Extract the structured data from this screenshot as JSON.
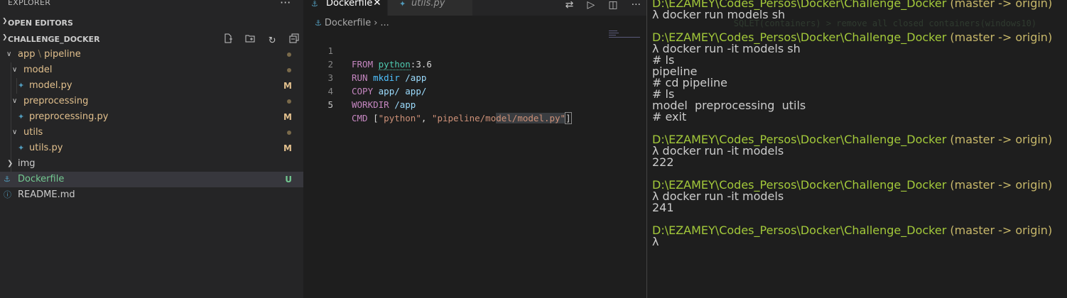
{
  "sidebar": {
    "title": "EXPLORER",
    "more_icon": "ellipsis-icon",
    "open_editors_label": "OPEN EDITORS",
    "project_label": "CHALLENGE_DOCKER",
    "project_tools": [
      "new-file-icon",
      "new-folder-icon",
      "refresh-icon",
      "collapse-all-icon"
    ],
    "tree": [
      {
        "name": "app",
        "name2": "pipeline",
        "type": "folder",
        "status": ""
      },
      {
        "name": "model",
        "type": "folder",
        "status": ""
      },
      {
        "name": "model.py",
        "type": "python",
        "status": "M"
      },
      {
        "name": "preprocessing",
        "type": "folder",
        "status": ""
      },
      {
        "name": "preprocessing.py",
        "type": "python",
        "status": "M"
      },
      {
        "name": "utils",
        "type": "folder",
        "status": ""
      },
      {
        "name": "utils.py",
        "type": "python",
        "status": "M"
      },
      {
        "name": "img",
        "type": "folder",
        "status": ""
      },
      {
        "name": "Dockerfile",
        "type": "docker",
        "status": "U"
      },
      {
        "name": "README.md",
        "type": "info",
        "status": ""
      }
    ]
  },
  "editor": {
    "tabs": [
      {
        "label": "Dockerfile",
        "active": true
      },
      {
        "label": "utils.py",
        "active": false
      }
    ],
    "breadcrumb": {
      "file": "Dockerfile",
      "rest": "..."
    },
    "code": [
      {
        "n": "1",
        "t1": "FROM",
        "t2": "python",
        "t3": ":3.6"
      },
      {
        "n": "2",
        "t1": "RUN",
        "t2": "mkdir",
        "t3": " /app"
      },
      {
        "n": "3",
        "t1": "COPY",
        "t2": "app/ app/"
      },
      {
        "n": "4",
        "t1": "WORKDIR",
        "t2": " /app"
      },
      {
        "n": "5",
        "t1": "CMD",
        "t2": " [",
        "t3": "\"python\"",
        "t4": ", ",
        "t5": "\"pipeline/mo",
        "t6": "del/model.py\"",
        "t7": "]"
      }
    ]
  },
  "terminal": {
    "ghost": "        SQLET(containers) > remove all closed containers(windows10)",
    "prompt_path": "D:\\EZAMEY\\Codes_Persos\\Docker\\Challenge_Docker",
    "prompt_branch": " (master -> origin)",
    "lines": [
      "λ docker run models sh",
      "λ docker run -it models sh",
      "# ls",
      "pipeline",
      "# cd pipeline",
      "# ls",
      "model  preprocessing  utils",
      "# exit",
      "λ docker run -it models",
      "222",
      "λ docker run -it models",
      "241",
      "λ"
    ]
  }
}
